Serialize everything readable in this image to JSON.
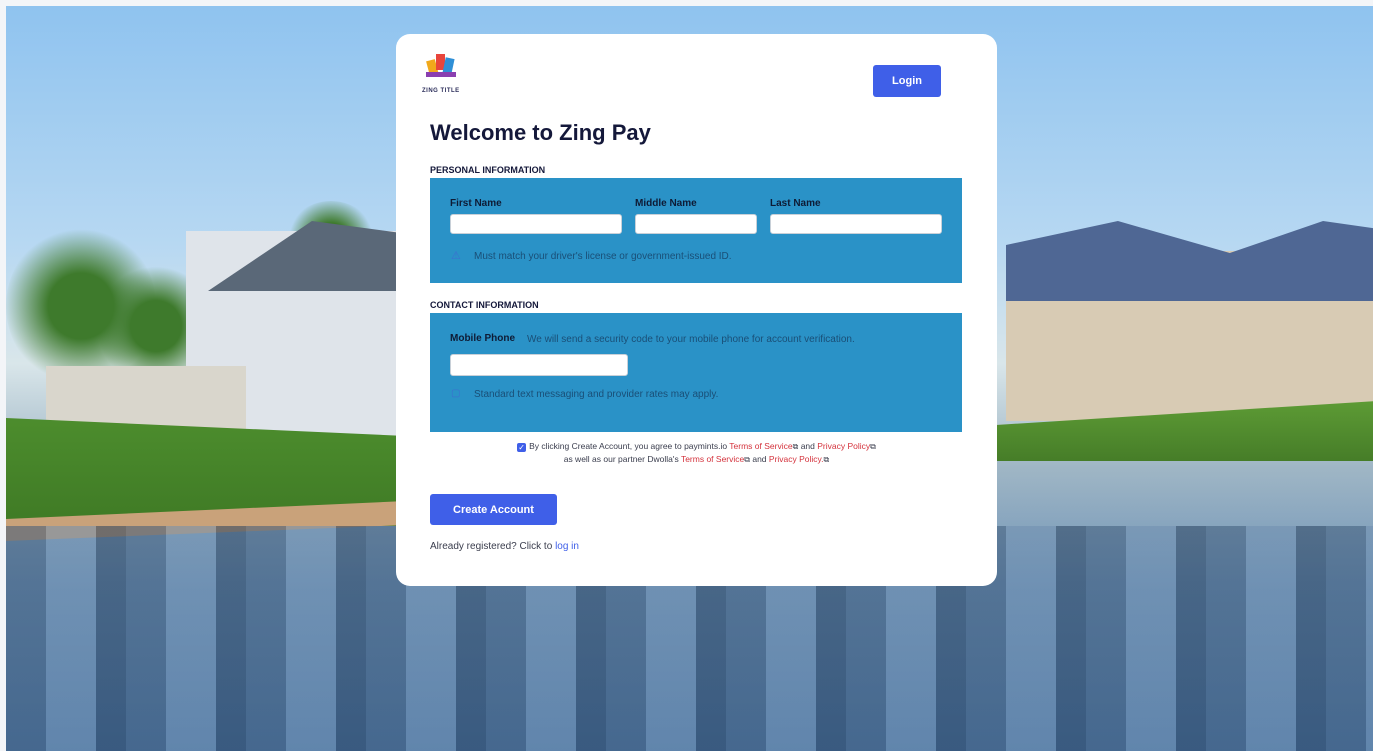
{
  "logo": {
    "text": "ZING TITLE"
  },
  "header": {
    "login_label": "Login"
  },
  "page": {
    "title": "Welcome to Zing Pay"
  },
  "personal": {
    "section_title": "PERSONAL INFORMATION",
    "first_name_label": "First Name",
    "middle_name_label": "Middle Name",
    "last_name_label": "Last Name",
    "first_name_value": "",
    "middle_name_value": "",
    "last_name_value": "",
    "hint": "Must match your driver's license or government-issued ID."
  },
  "contact": {
    "section_title": "CONTACT INFORMATION",
    "mobile_label": "Mobile Phone",
    "mobile_note": "We will send a security code to your mobile phone for account verification.",
    "mobile_value": "",
    "sms_note": "Standard text messaging and provider rates may apply."
  },
  "agreement": {
    "line1_prefix": "By clicking Create Account, you agree to paymints.io",
    "terms1": "Terms of Service",
    "and1": "and",
    "privacy1": "Privacy Policy",
    "line2_prefix": "as well as our partner Dwolla's",
    "terms2": "Terms of Service",
    "and2": "and",
    "privacy2": "Privacy Policy."
  },
  "actions": {
    "create_label": "Create Account"
  },
  "footer": {
    "already_text": "Already registered? Click to",
    "login_link": "log in"
  },
  "colors": {
    "accent": "#3f5fe8",
    "panel": "#2a92c7",
    "link_red": "#d4323c"
  }
}
